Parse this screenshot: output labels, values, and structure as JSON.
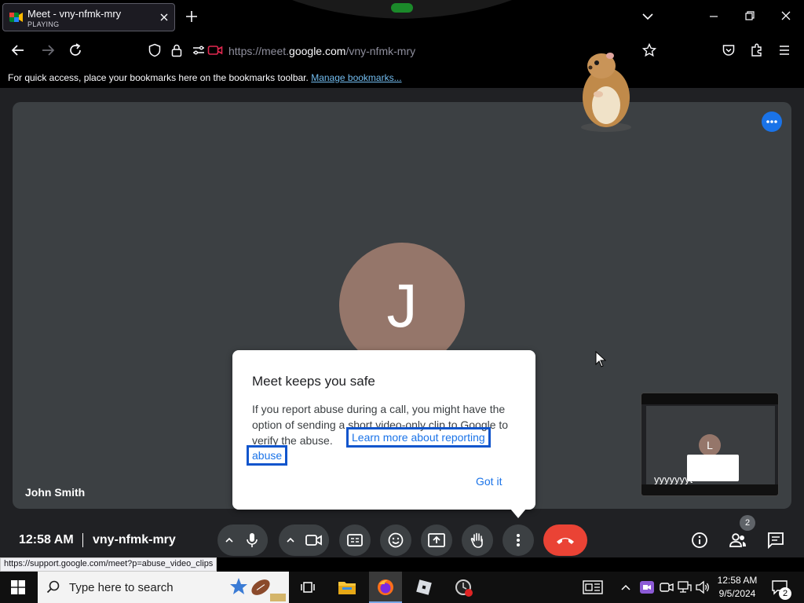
{
  "browser": {
    "tab": {
      "title": "Meet - vny-nfmk-mry",
      "status": "PLAYING"
    },
    "url": {
      "prefix": "https://meet.",
      "host": "google.com",
      "path": "/vny-nfmk-mry"
    },
    "bookmarks": {
      "message": "For quick access, place your bookmarks here on the bookmarks toolbar.",
      "link": "Manage bookmarks..."
    },
    "status_url": "https://support.google.com/meet?p=abuse_video_clips"
  },
  "meet": {
    "participant": {
      "initial": "J",
      "name": "John Smith"
    },
    "self_view": {
      "initial": "L",
      "overlay_text": "yyyyyyyt"
    },
    "dialog": {
      "title": "Meet keeps you safe",
      "body": "If you report abuse during a call, you might have the option of sending a short video-only clip to Google to verify the abuse.",
      "link_line1": "Learn more about reporting",
      "link_line2": "abuse",
      "button": "Got it"
    },
    "bottom": {
      "time": "12:58 AM",
      "code": "vny-nfmk-mry",
      "people_count": "2"
    },
    "colors": {
      "end_call": "#ea4335",
      "accent": "#1a73e8",
      "avatar": "#95766a"
    }
  },
  "taskbar": {
    "search_placeholder": "Type here to search",
    "time": "12:58 AM",
    "date": "9/5/2024",
    "notification_count": "2"
  }
}
